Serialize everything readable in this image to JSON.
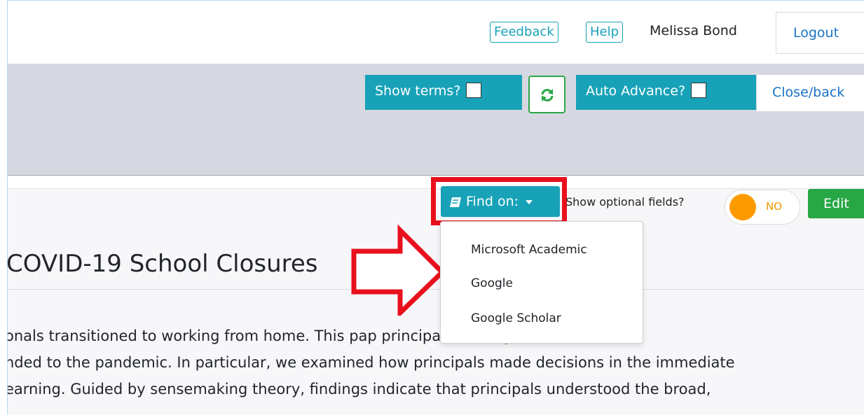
{
  "header": {
    "feedback_label": "Feedback",
    "help_label": "Help",
    "user_name": "Melissa Bond",
    "logout_label": "Logout"
  },
  "toolbar": {
    "show_terms_label": "Show terms?",
    "show_terms_checked": false,
    "refresh_icon": "refresh-icon",
    "auto_advance_label": "Auto Advance?",
    "auto_advance_checked": false,
    "close_back_label": "Close/back"
  },
  "record_toolbar": {
    "find_on_label": "Find on:",
    "find_on_icon": "book-icon",
    "optional_fields_label": "Show optional fields?",
    "toggle_state_label": "NO",
    "edit_label": "Edit"
  },
  "find_on_menu": {
    "items": [
      "Microsoft Academic",
      "Google",
      "Google Scholar"
    ]
  },
  "record": {
    "title": "COVID-19 School Closures",
    "abstract_lines": [
      "onals transitioned to working from home. This pap                                principals leading",
      "nded to the pandemic. In particular, we examined how principals made decisions in the immediate",
      "earning. Guided by sensemaking theory, findings indicate that principals understood the broad,"
    ]
  },
  "colors": {
    "teal": "#17a2b8",
    "green": "#28a745",
    "highlight_red": "#e8101c",
    "toggle_orange": "#fd9a00",
    "band_gray": "#d6d8e1"
  }
}
